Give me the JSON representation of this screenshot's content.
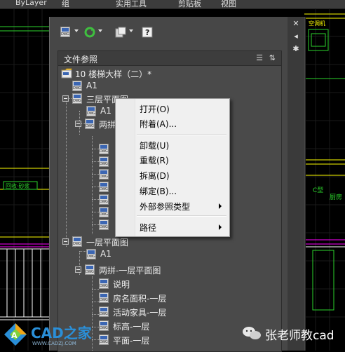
{
  "topbar": {
    "layer_label": "ByLayer",
    "menu1": "组",
    "menu2": "实用工具",
    "menu3": "剪贴板",
    "menu4": "视图"
  },
  "canvas": {
    "left_green_label": "回收·砂浆",
    "right_top_label": "空调机",
    "right_mid_label_a": "C型",
    "right_mid_label_b": "厨房"
  },
  "panel": {
    "title": "文件参照",
    "toolbar": [
      "attach-dwg-icon",
      "refresh-icon",
      "change-path-icon",
      "help-icon"
    ],
    "side_icons": [
      "close-icon",
      "autohide-icon",
      "properties-icon"
    ]
  },
  "tree": {
    "nodes": [
      {
        "label": "10 楼梯大样（二）*",
        "kind": "root"
      },
      {
        "label": "A1"
      },
      {
        "label": "三层平面图"
      },
      {
        "label": "A1"
      },
      {
        "label": "两拼"
      },
      {
        "label": ""
      },
      {
        "label": ""
      },
      {
        "label": ""
      },
      {
        "label": ""
      },
      {
        "label": ""
      },
      {
        "label": ""
      },
      {
        "label": ""
      },
      {
        "label": "一层平面图"
      },
      {
        "label": "A1"
      },
      {
        "label": "两拼-一层平面图"
      },
      {
        "label": "说明"
      },
      {
        "label": "房名面积-一层"
      },
      {
        "label": "活动家具-一层"
      },
      {
        "label": "标高-一层"
      },
      {
        "label": "平面-一层"
      }
    ]
  },
  "context_menu": {
    "items": [
      {
        "label": "打开(O)",
        "submenu": false
      },
      {
        "label": "附着(A)...",
        "submenu": false
      },
      {
        "label": "卸载(U)",
        "submenu": false
      },
      {
        "label": "重载(R)",
        "submenu": false
      },
      {
        "label": "拆离(D)",
        "submenu": false
      },
      {
        "label": "绑定(B)...",
        "submenu": false
      },
      {
        "label": "外部参照类型",
        "submenu": true
      },
      {
        "label": "路径",
        "submenu": true
      }
    ]
  },
  "watermarks": {
    "logo_cn": "CAD之家",
    "logo_url": "WWW.CADZJ.COM",
    "wechat": "张老师教cad"
  },
  "colors": {
    "panel": "#474747",
    "tree": "#4a4a4a",
    "menu": "#f0f0f0",
    "cad_green": "#2bd42b",
    "cad_yellow": "#ffff00",
    "cad_magenta": "#ff00ff"
  }
}
